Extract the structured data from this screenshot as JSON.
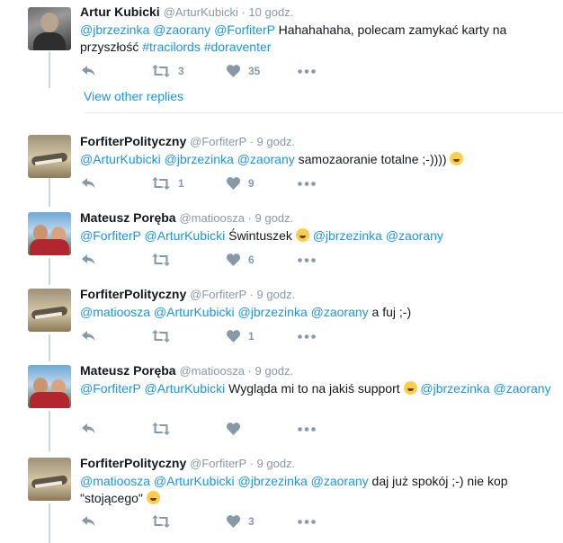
{
  "tweets": [
    {
      "name": "Artur Kubicki",
      "handle": "@ArturKubicki",
      "sep": " · ",
      "time": "10 godz.",
      "text": [
        {
          "t": "@jbrzezinka",
          "link": true
        },
        {
          "t": " "
        },
        {
          "t": "@zaorany",
          "link": true
        },
        {
          "t": " "
        },
        {
          "t": "@ForfiterP",
          "link": true
        },
        {
          "t": "  Hahahahaha, polecam zamykać karty na przyszłość "
        },
        {
          "t": "#tracilords",
          "link": true
        },
        {
          "t": "  "
        },
        {
          "t": "#doraventer",
          "link": true
        }
      ],
      "retweets": "3",
      "likes": "35",
      "avatar": "av-artur"
    },
    {
      "name": "ForfiterPolityczny",
      "handle": "@ForfiterP",
      "sep": " · ",
      "time": "9 godz.",
      "text": [
        {
          "t": "@ArturKubicki",
          "link": true
        },
        {
          "t": " "
        },
        {
          "t": "@jbrzezinka",
          "link": true
        },
        {
          "t": " "
        },
        {
          "t": "@zaorany",
          "link": true
        },
        {
          "t": " samozaoranie totalne ;-)))) "
        },
        {
          "emoji": "grinning-emoji"
        }
      ],
      "retweets": "1",
      "likes": "9",
      "avatar": "av-forfiter"
    },
    {
      "name": "Mateusz Poręba",
      "handle": "@matioosza",
      "sep": " · ",
      "time": "9 godz.",
      "text": [
        {
          "t": "@ForfiterP",
          "link": true
        },
        {
          "t": " "
        },
        {
          "t": "@ArturKubicki",
          "link": true
        },
        {
          "t": " Świntuszek  "
        },
        {
          "emoji": "laughing-emoji"
        },
        {
          "t": " "
        },
        {
          "t": "@jbrzezinka",
          "link": true
        },
        {
          "t": " "
        },
        {
          "t": "@zaorany",
          "link": true
        }
      ],
      "retweets": "",
      "likes": "6",
      "avatar": "av-mateusz"
    },
    {
      "name": "ForfiterPolityczny",
      "handle": "@ForfiterP",
      "sep": " · ",
      "time": "9 godz.",
      "text": [
        {
          "t": "@matioosza",
          "link": true
        },
        {
          "t": " "
        },
        {
          "t": "@ArturKubicki",
          "link": true
        },
        {
          "t": " "
        },
        {
          "t": "@jbrzezinka",
          "link": true
        },
        {
          "t": " "
        },
        {
          "t": "@zaorany",
          "link": true
        },
        {
          "t": " a fuj ;-)"
        }
      ],
      "retweets": "",
      "likes": "1",
      "avatar": "av-forfiter"
    },
    {
      "name": "Mateusz Poręba",
      "handle": "@matioosza",
      "sep": " · ",
      "time": "9 godz.",
      "text": [
        {
          "t": "@ForfiterP",
          "link": true
        },
        {
          "t": " "
        },
        {
          "t": "@ArturKubicki",
          "link": true
        },
        {
          "t": " Wygląda mi to na jakiś support "
        },
        {
          "emoji": "grimacing-emoji"
        },
        {
          "t": " "
        },
        {
          "t": "@jbrzezinka",
          "link": true
        },
        {
          "t": " "
        },
        {
          "t": "@zaorany",
          "link": true
        }
      ],
      "retweets": "",
      "likes": "",
      "avatar": "av-mateusz"
    },
    {
      "name": "ForfiterPolityczny",
      "handle": "@ForfiterP",
      "sep": " · ",
      "time": "9 godz.",
      "text": [
        {
          "t": "@matioosza",
          "link": true
        },
        {
          "t": " "
        },
        {
          "t": "@ArturKubicki",
          "link": true
        },
        {
          "t": " "
        },
        {
          "t": "@jbrzezinka",
          "link": true
        },
        {
          "t": " "
        },
        {
          "t": "@zaorany",
          "link": true
        },
        {
          "t": " daj już spokój ;-) nie kop \"stojącego\" "
        },
        {
          "emoji": "grinning-emoji"
        }
      ],
      "retweets": "",
      "likes": "3",
      "avatar": "av-forfiter"
    }
  ],
  "view_other_replies": "View other replies",
  "colors": {
    "link": "#1b95e0",
    "meta": "#8899a6",
    "icon": "#8899a6",
    "thread_line": "#ccd6dd"
  }
}
